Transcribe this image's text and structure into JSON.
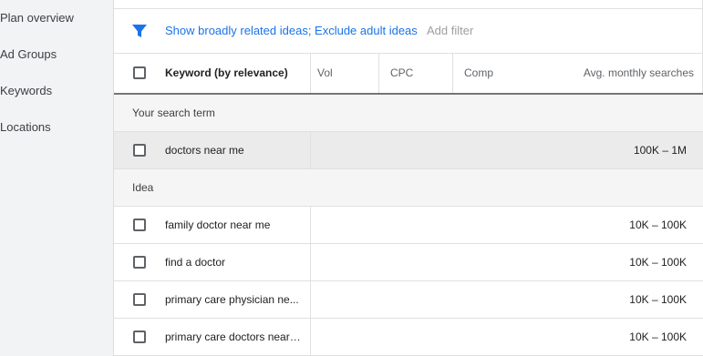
{
  "sidebar": {
    "items": [
      {
        "label": "Plan overview"
      },
      {
        "label": "Ad Groups"
      },
      {
        "label": "Keywords"
      },
      {
        "label": "Locations"
      }
    ]
  },
  "filter_bar": {
    "filters_label": "Show broadly related ideas; Exclude adult ideas",
    "add_filter_label": "Add filter"
  },
  "table": {
    "columns": {
      "keyword": "Keyword (by relevance)",
      "vol": "Vol",
      "cpc": "CPC",
      "comp": "Comp",
      "avg_monthly": "Avg. monthly searches"
    },
    "search_term_section": "Your search term",
    "idea_section": "Idea",
    "search_terms": [
      {
        "keyword": "doctors near me",
        "avg": "100K – 1M"
      }
    ],
    "ideas": [
      {
        "keyword": "family doctor near me",
        "avg": "10K – 100K"
      },
      {
        "keyword": "find a doctor",
        "avg": "10K – 100K"
      },
      {
        "keyword": "primary care physician ne...",
        "avg": "10K – 100K"
      },
      {
        "keyword": "primary care doctors near ...",
        "avg": "10K – 100K"
      }
    ]
  },
  "icons": {
    "filter": "filter-funnel-icon"
  },
  "colors": {
    "accent": "#1a73e8",
    "sidebar_bg": "#f1f3f4",
    "section_bg": "#f5f5f5",
    "highlight_row_bg": "#ebebeb"
  }
}
